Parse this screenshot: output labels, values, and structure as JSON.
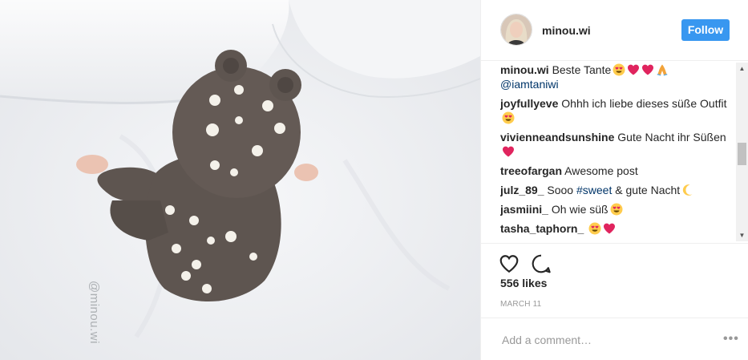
{
  "post": {
    "username": "minou.wi",
    "follow_label": "Follow",
    "watermark": "@minou.wi",
    "comments": [
      {
        "user": "minou.wi",
        "text": "Beste Tante",
        "emojis": [
          "heart-eyes-emoji",
          "red-heart-emoji",
          "red-heart-emoji",
          "pray-emoji"
        ]
      },
      {
        "mention": "@iamtaniwi"
      },
      {
        "user": "joyfullyeve",
        "text": "Ohhh ich liebe dieses süße Outfit",
        "emojis": [
          "heart-eyes-emoji"
        ]
      },
      {
        "user": "vivienneandsunshine",
        "text": "Gute Nacht ihr Süßen",
        "emojis": [
          "red-heart-emoji"
        ]
      },
      {
        "user": "treeofargan",
        "text": "Awesome post",
        "emojis": []
      },
      {
        "user": "julz_89_",
        "text_before": "Sooo",
        "hashtag": "#sweet",
        "text_after": "& gute Nacht",
        "emojis": [
          "moon-emoji"
        ]
      },
      {
        "user": "jasmiini_",
        "text": "Oh wie süß",
        "emojis": [
          "heart-eyes-emoji"
        ]
      },
      {
        "user": "tasha_taphorn_",
        "text": "",
        "emojis": [
          "heart-eyes-emoji",
          "red-heart-emoji"
        ]
      }
    ],
    "likes": "556 likes",
    "date": "MARCH 11",
    "comment_placeholder": "Add a comment…",
    "more_label": "•••"
  },
  "colors": {
    "accent": "#3897f0",
    "link": "#003569",
    "heart": "#ed4956"
  },
  "icons": [
    "heart-outline-icon",
    "comment-bubble-icon",
    "more-options-icon"
  ]
}
